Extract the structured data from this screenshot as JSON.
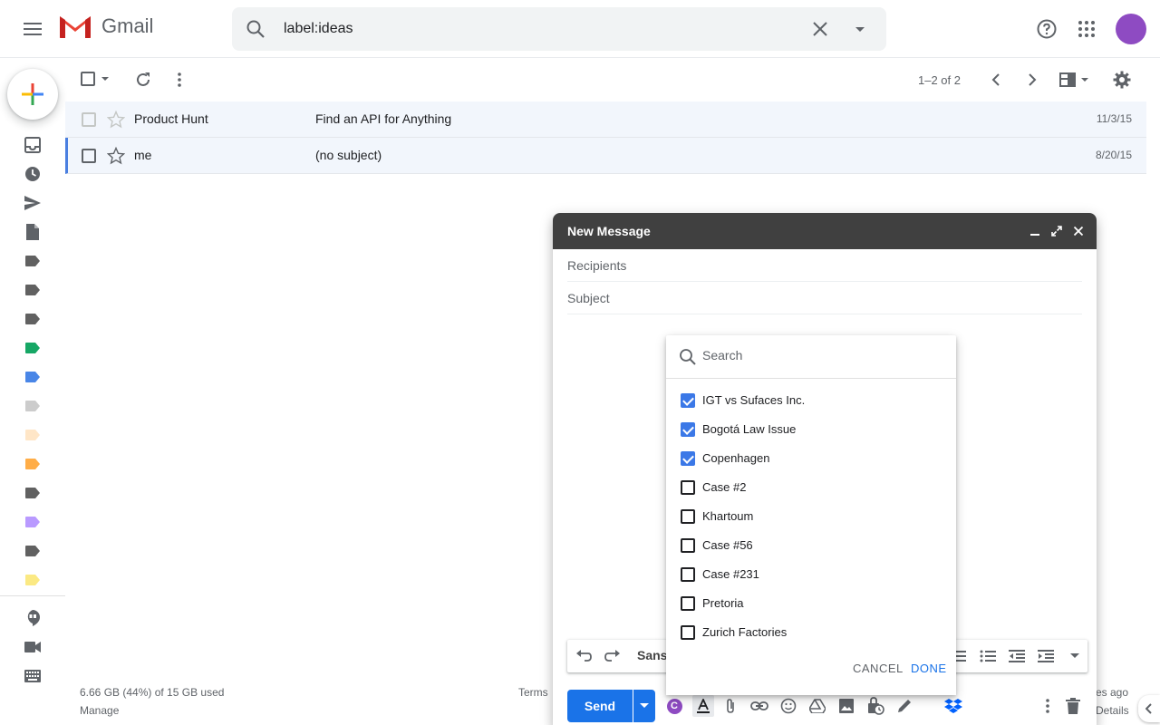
{
  "header": {
    "app_name": "Gmail",
    "search_value": "label:ideas"
  },
  "toolbar": {
    "page_count": "1–2 of 2"
  },
  "emails": [
    {
      "sender": "Product Hunt",
      "subject": "Find an API for Anything",
      "date": "11/3/15"
    },
    {
      "sender": "me",
      "subject": "(no subject)",
      "date": "8/20/15"
    }
  ],
  "rail": {
    "label_colors": [
      "#616161",
      "#616161",
      "#616161",
      "#16a765",
      "#4986e7",
      "#cccccc",
      "#ffe6c7",
      "#ffad47",
      "#616161",
      "#b99aff",
      "#616161",
      "#fbe983"
    ]
  },
  "footer": {
    "storage": "6.66 GB (44%) of 15 GB used",
    "manage": "Manage",
    "terms": "Terms",
    "activity": "es ago",
    "details": "Details"
  },
  "compose": {
    "title": "New Message",
    "recipients_placeholder": "Recipients",
    "subject_placeholder": "Subject",
    "font": "Sans",
    "send_label": "Send",
    "badge_letter": "C"
  },
  "label_popup": {
    "search_placeholder": "Search",
    "labels": [
      {
        "name": "IGT vs Sufaces Inc.",
        "checked": true
      },
      {
        "name": "Bogotá Law Issue",
        "checked": true
      },
      {
        "name": "Copenhagen",
        "checked": true
      },
      {
        "name": "Case #2",
        "checked": false
      },
      {
        "name": "Khartoum",
        "checked": false
      },
      {
        "name": "Case #56",
        "checked": false
      },
      {
        "name": "Case #231",
        "checked": false
      },
      {
        "name": "Pretoria",
        "checked": false
      },
      {
        "name": "Zurich Factories",
        "checked": false
      }
    ],
    "cancel_label": "CANCEL",
    "done_label": "DONE"
  },
  "colors": {
    "accent": "#1a73e8",
    "checkbox_checked": "#3b78e7",
    "compose_header": "#404040",
    "avatar": "#8e4bc2"
  }
}
